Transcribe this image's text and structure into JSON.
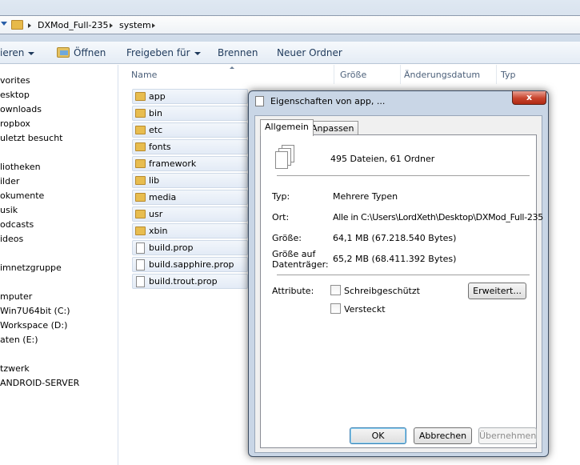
{
  "address": {
    "crumbs": [
      "DXMod_Full-235",
      "system"
    ]
  },
  "toolbar": {
    "organize": "ieren",
    "open": "Öffnen",
    "share": "Freigeben für",
    "burn": "Brennen",
    "new_folder": "Neuer Ordner"
  },
  "nav": {
    "items": [
      "vorites",
      "esktop",
      "ownloads",
      "ropbox",
      "uletzt besucht",
      "liotheken",
      "ilder",
      "okumente",
      "usik",
      "odcasts",
      "ideos",
      "imnetzgruppe",
      "mputer",
      "Win7U64bit (C:)",
      "Workspace (D:)",
      "aten (E:)",
      "tzwerk",
      "ANDROID-SERVER"
    ]
  },
  "list": {
    "columns": [
      "Name",
      "Größe",
      "Änderungsdatum",
      "Typ"
    ],
    "folders": [
      "app",
      "bin",
      "etc",
      "fonts",
      "framework",
      "lib",
      "media",
      "usr",
      "xbin"
    ],
    "files": [
      "build.prop",
      "build.sapphire.prop",
      "build.trout.prop"
    ]
  },
  "dialog": {
    "title": "Eigenschaften von app, ...",
    "close": "x",
    "tabs": [
      "Allgemein",
      "Anpassen"
    ],
    "summary": "495 Dateien, 61 Ordner",
    "type_label": "Typ:",
    "type_value": "Mehrere Typen",
    "location_label": "Ort:",
    "location_value": "Alle in C:\\Users\\LordXeth\\Desktop\\DXMod_Full-235",
    "size_label": "Größe:",
    "size_value": "64,1 MB (67.218.540 Bytes)",
    "disk_label_1": "Größe auf",
    "disk_label_2": "Datenträger:",
    "disk_value": "65,2 MB (68.411.392 Bytes)",
    "attributes_label": "Attribute:",
    "readonly_label": "Schreibgeschützt",
    "hidden_label": "Versteckt",
    "advanced_button": "Erweitert...",
    "ok_button": "OK",
    "cancel_button": "Abbrechen",
    "apply_button": "Übernehmen"
  }
}
